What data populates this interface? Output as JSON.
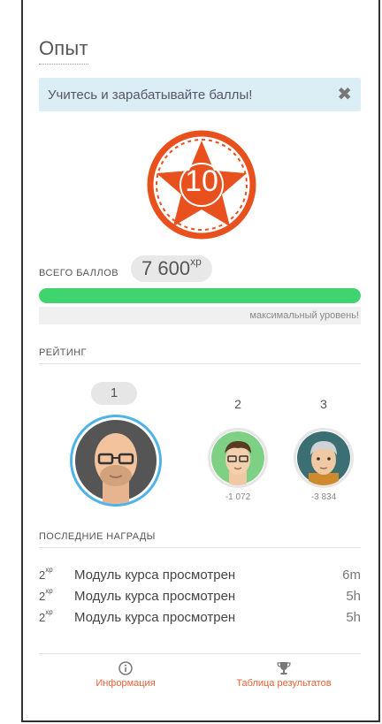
{
  "header": {
    "title": "Опыт"
  },
  "alert": {
    "text": "Учитесь и зарабатывайте баллы!",
    "close_glyph": "✖"
  },
  "badge": {
    "level": "10",
    "color": "#e8501e"
  },
  "points": {
    "label": "ВСЕГО БАЛЛОВ",
    "value": "7 600",
    "unit": "xp",
    "progress_fraction": 1.0,
    "progress_color": "#3fd46e",
    "progress_caption": "максимальный уровень!"
  },
  "rating": {
    "heading": "РЕЙТИНГ",
    "entries": [
      {
        "rank": "1",
        "score": ""
      },
      {
        "rank": "2",
        "score": "-1 072"
      },
      {
        "rank": "3",
        "score": "-3 834"
      }
    ]
  },
  "awards": {
    "heading": "ПОСЛЕДНИЕ НАГРАДЫ",
    "items": [
      {
        "xp": "2",
        "unit": "xp",
        "text": "Модуль курса просмотрен",
        "time": "6m"
      },
      {
        "xp": "2",
        "unit": "xp",
        "text": "Модуль курса просмотрен",
        "time": "5h"
      },
      {
        "xp": "2",
        "unit": "xp",
        "text": "Модуль курса просмотрен",
        "time": "5h"
      }
    ]
  },
  "footer": {
    "info": {
      "label": "Информация",
      "icon": "info-icon"
    },
    "leaderboard": {
      "label": "Таблица результатов",
      "icon": "trophy-icon"
    }
  }
}
